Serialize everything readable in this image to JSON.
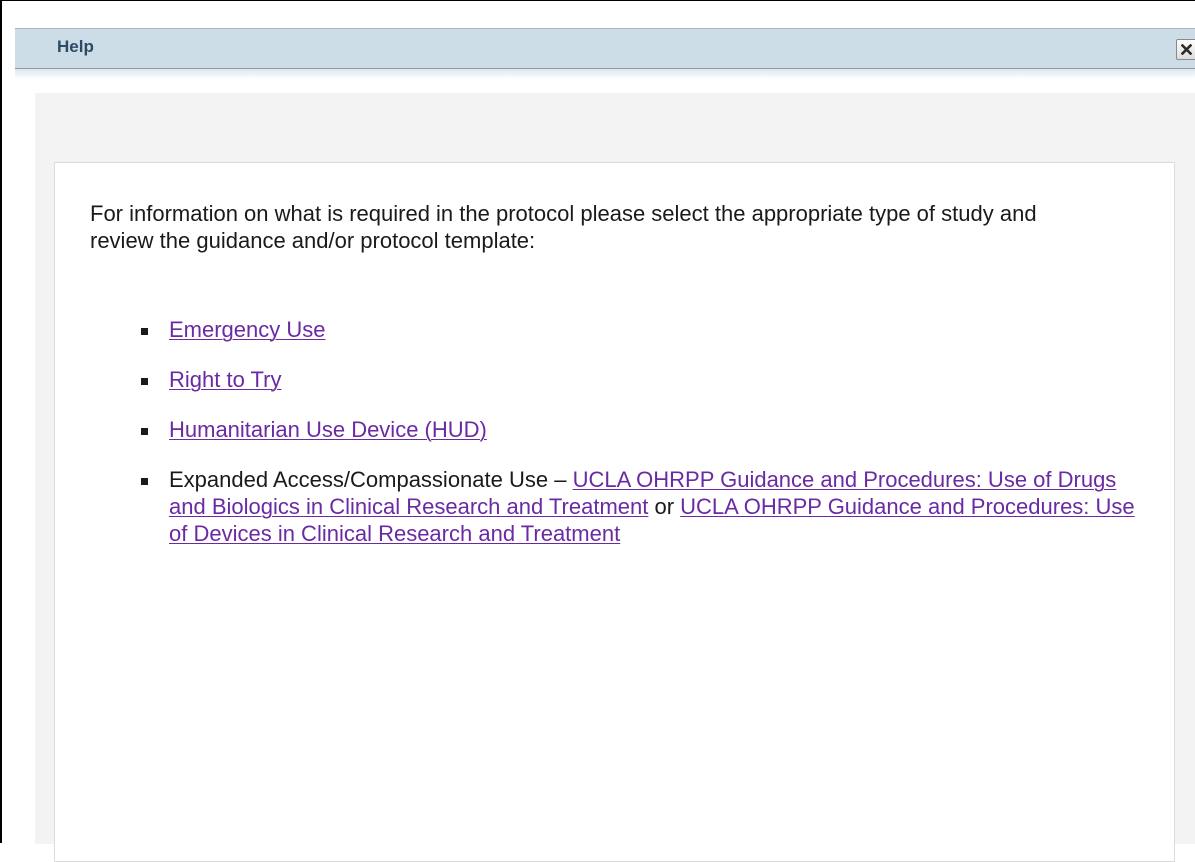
{
  "dialog": {
    "title": "Help",
    "close_icon": "close-icon"
  },
  "content": {
    "intro": "For information on what is required in the protocol please select the appropriate type of study and review the guidance and/or protocol template:",
    "items": [
      {
        "link": "Emergency Use"
      },
      {
        "link": "Right to Try"
      },
      {
        "link": "Humanitarian Use Device (HUD)"
      },
      {
        "prefix": "Expanded Access/Compassionate Use – ",
        "link1": "UCLA OHRPP Guidance and Procedures: Use of Drugs and Biologics in Clinical Research and Treatment",
        "separator": " or ",
        "link2": "UCLA OHRPP Guidance and Procedures: Use of Devices in Clinical Research and Treatment"
      }
    ]
  },
  "colors": {
    "titlebar": "#cddde8",
    "title_text": "#2f4a63",
    "link": "#6a2aa3"
  }
}
